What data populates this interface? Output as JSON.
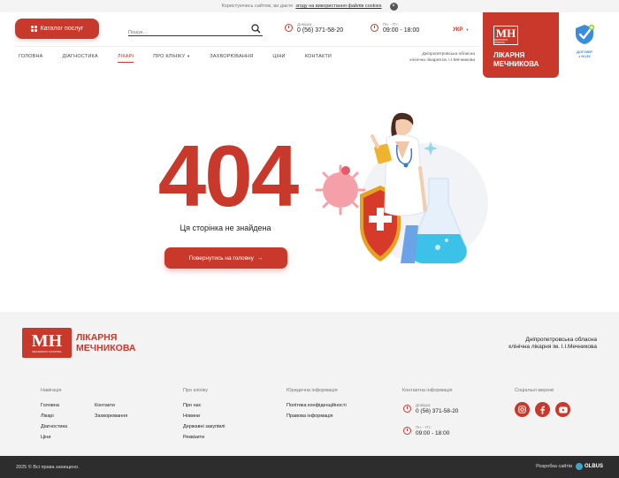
{
  "cookie": {
    "text": "Користуючись сайтом, ви даєте",
    "link": "згоду на використання файлів cookies"
  },
  "header": {
    "catalog_label": "Каталог послуг",
    "search_placeholder": "Пошук...",
    "phone_label": "Довідка:",
    "phone": "0 (56) 371-58-20",
    "hours_label": "Пн. - Пт.:",
    "hours": "09:00 - 18:00",
    "lang": "УКР",
    "logo_title_line1": "ЛІКАРНЯ",
    "logo_title_line2": "МЕЧНИКОВА",
    "logo_mark": "MH",
    "logo_mark_small": "MECHNIKOV HOSPITAL",
    "nszu_line1": "ДОГОВІР",
    "nszu_line2": "з НСЗУ",
    "org_line1": "Дніпропетровська обласна",
    "org_line2": "клінічна лікарня ім. І.І.Мечникова"
  },
  "nav": {
    "items": [
      {
        "label": "ГОЛОВНА"
      },
      {
        "label": "ДІАГНОСТИКА"
      },
      {
        "label": "ЛІКАРІ"
      },
      {
        "label": "ПРО КЛІНІКУ"
      },
      {
        "label": "ЗАХВОРЮВАННЯ"
      },
      {
        "label": "ЦІНИ"
      },
      {
        "label": "КОНТАКТИ"
      }
    ]
  },
  "main": {
    "code": "404",
    "message": "Ця сторінка не знайдена",
    "back_label": "Повернутись на головну"
  },
  "footer": {
    "logo_title_line1": "ЛІКАРНЯ",
    "logo_title_line2": "МЕЧНИКОВА",
    "org_line1": "Дніпропетровська обласна",
    "org_line2": "клінічна лікарня ім. І.І.Мечникова",
    "nav_heading": "Навігація",
    "nav_col1": [
      "Головна",
      "Лікарі",
      "Діагностика",
      "Ціни"
    ],
    "nav_col2": [
      "Контакти",
      "Захворювання"
    ],
    "about_heading": "Про клініку",
    "about_links": [
      "Про нас",
      "Новини",
      "Державні закупівлі",
      "Реквізити"
    ],
    "legal_heading": "Юридична інформація",
    "legal_links": [
      "Політика конфіденційності",
      "Правова інформація"
    ],
    "contact_heading": "Контактна інформація",
    "phone_label": "Довідка:",
    "phone": "0 (56) 371-58-20",
    "hours_label": "Пн. - Пт.:",
    "hours": "09:00 - 18:00",
    "social_heading": "Соціальні мережі"
  },
  "bottom": {
    "copyright": "2025 © Всі права захищено.",
    "dev_label": "Розробка сайтів",
    "dev_brand": "OLBUS"
  },
  "colors": {
    "brand": "#c8392b",
    "dark": "#2d2d2d",
    "footer_bg": "#f3f3f3"
  }
}
